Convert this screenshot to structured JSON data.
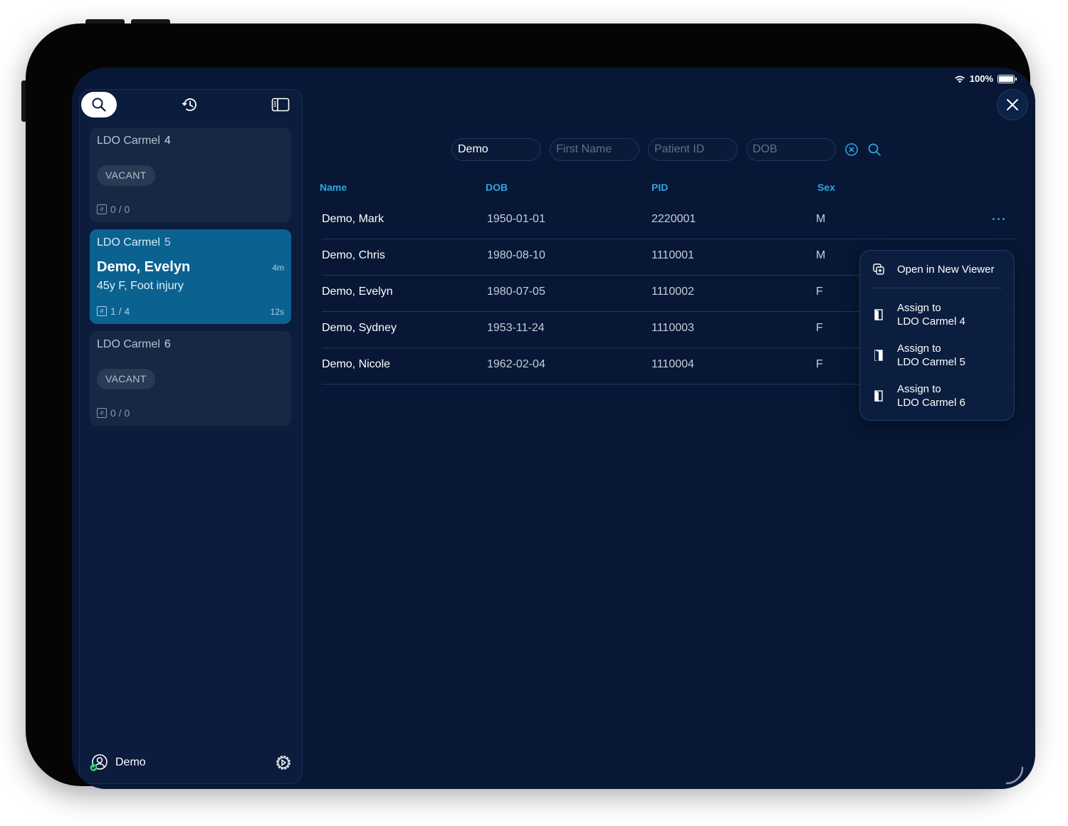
{
  "status_bar": {
    "battery": "100%"
  },
  "sidebar": {
    "beds": [
      {
        "title": "LDO Carmel",
        "number": "4",
        "status": "VACANT",
        "count": "0 / 0"
      },
      {
        "title": "LDO Carmel",
        "number": "5",
        "patient": "Demo, Evelyn",
        "info": "45y F, Foot injury",
        "time_admitted": "4m",
        "count": "1 / 4",
        "time_updated": "12s"
      },
      {
        "title": "LDO Carmel",
        "number": "6",
        "status": "VACANT",
        "count": "0 / 0"
      }
    ],
    "user": "Demo"
  },
  "search": {
    "last_name": "Demo",
    "first_name_placeholder": "First Name",
    "patient_id_placeholder": "Patient ID",
    "dob_placeholder": "DOB"
  },
  "table": {
    "headers": {
      "name": "Name",
      "dob": "DOB",
      "pid": "PID",
      "sex": "Sex"
    },
    "rows": [
      {
        "name": "Demo, Mark",
        "dob": "1950-01-01",
        "pid": "2220001",
        "sex": "M"
      },
      {
        "name": "Demo, Chris",
        "dob": "1980-08-10",
        "pid": "1110001",
        "sex": "M"
      },
      {
        "name": "Demo, Evelyn",
        "dob": "1980-07-05",
        "pid": "1110002",
        "sex": "F"
      },
      {
        "name": "Demo, Sydney",
        "dob": "1953-11-24",
        "pid": "1110003",
        "sex": "F"
      },
      {
        "name": "Demo, Nicole",
        "dob": "1962-02-04",
        "pid": "1110004",
        "sex": "F"
      }
    ],
    "more_label": "···"
  },
  "context_menu": {
    "open_viewer": "Open in New Viewer",
    "assign": [
      {
        "line1": "Assign to",
        "line2": "LDO Carmel 4"
      },
      {
        "line1": "Assign to",
        "line2": "LDO Carmel 5"
      },
      {
        "line1": "Assign to",
        "line2": "LDO Carmel 6"
      }
    ]
  },
  "colors": {
    "background": "#071735",
    "accent": "#2ea6e0",
    "active_card": "#0b6291"
  }
}
